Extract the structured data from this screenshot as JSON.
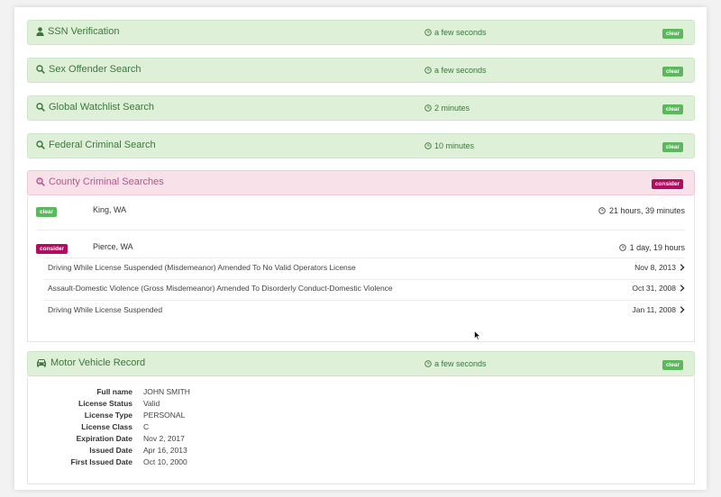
{
  "sections": [
    {
      "title": "SSN Verification",
      "icon": "user-icon",
      "time": "a few seconds",
      "status": "clear"
    },
    {
      "title": "Sex Offender Search",
      "icon": "search-icon",
      "time": "a few seconds",
      "status": "clear"
    },
    {
      "title": "Global Watchlist Search",
      "icon": "search-icon",
      "time": "2 minutes",
      "status": "clear"
    },
    {
      "title": "Federal Criminal Search",
      "icon": "search-icon",
      "time": "10 minutes",
      "status": "clear"
    }
  ],
  "county": {
    "title": "County Criminal Searches",
    "icon": "search-warning-icon",
    "status": "consider",
    "rows": [
      {
        "status": "clear",
        "location": "King, WA",
        "time": "21 hours, 39 minutes"
      },
      {
        "status": "consider",
        "location": "Pierce, WA",
        "time": "1 day, 19 hours"
      }
    ],
    "charges": [
      {
        "text": "Driving While License Suspended (Misdemeanor) Amended To No Valid Operators License",
        "date": "Nov 8, 2013"
      },
      {
        "text": "Assault-Domestic Violence (Gross Misdemeanor) Amended To Disorderly Conduct-Domestic Violence",
        "date": "Oct 31, 2008"
      },
      {
        "text": "Driving While License Suspended",
        "date": "Jan 11, 2008"
      }
    ]
  },
  "mvr": {
    "title": "Motor Vehicle Record",
    "icon": "car-icon",
    "time": "a few seconds",
    "status": "clear",
    "fields": [
      {
        "label": "Full name",
        "value": "JOHN SMITH"
      },
      {
        "label": "License Status",
        "value": "Valid"
      },
      {
        "label": "License Type",
        "value": "PERSONAL"
      },
      {
        "label": "License Class",
        "value": "C"
      },
      {
        "label": "Expiration Date",
        "value": "Nov 2, 2017"
      },
      {
        "label": "Issued Date",
        "value": "Apr 16, 2013"
      },
      {
        "label": "First Issued Date",
        "value": "Oct 10, 2000"
      }
    ]
  },
  "colors": {
    "clear_bg": "#dff0d8",
    "clear_badge": "#5cb85c",
    "consider_bg": "#f9e1ea",
    "consider_badge": "#b20c5f"
  }
}
